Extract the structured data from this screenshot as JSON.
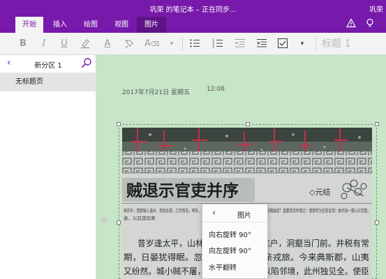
{
  "window": {
    "title": "巩荣 的笔记本 – 正在同步...",
    "user": "巩荣"
  },
  "ribbon_tabs": [
    {
      "label": "开始",
      "active": true
    },
    {
      "label": "插入",
      "active": false
    },
    {
      "label": "绘图",
      "active": false
    },
    {
      "label": "视图",
      "active": false
    },
    {
      "label": "图片",
      "active": false
    }
  ],
  "ribbon": {
    "style_label": "标题 1"
  },
  "nav": {
    "section": "新分区 1",
    "pages": [
      "无标题页"
    ]
  },
  "note": {
    "date": "2017年7月21日 星期五",
    "time": "12:08"
  },
  "photo": {
    "headline": "贼退示官吏并序",
    "author": "◇元结",
    "lines": [
      "癸卯岁，西原贼入道州，焚烧杀掠，几尽而去。明年，贼又攻永州，破邵，不犯此州边鄙而退。岂力能制敌欤？盖蒙其伤怜而已！诸使何为忍苦征敛！故作诗一篇以示官吏。",
      "昔岁逢太平，山林二十年。泉源在庭户，洞壑当门前。井税有常",
      "期，日晏犹得眠。忽然遭世变，数岁亲戎旅。今来典斯郡，山夷",
      "又纷然。城小贼不屠，人贫伤可怜。是以陷邻境，此州独见全。使臣"
    ]
  },
  "context_menu": {
    "title": "图片",
    "items": [
      "向右旋转 90°",
      "向左旋转 90°",
      "水平翻转"
    ]
  }
}
